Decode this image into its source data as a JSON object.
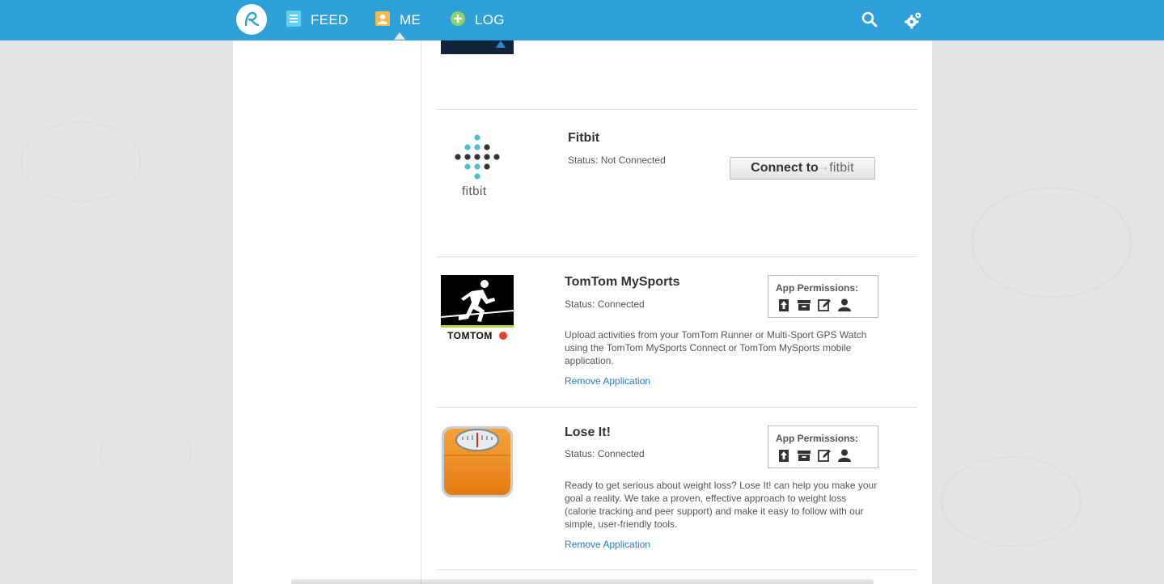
{
  "nav": {
    "logo_icon": "runkeeper-logo-icon",
    "items": [
      {
        "label": "FEED",
        "icon": "feed-icon",
        "icon_color": "#5fd0f2"
      },
      {
        "label": "ME",
        "icon": "me-icon",
        "icon_color": "#f5b94a"
      },
      {
        "label": "LOG",
        "icon": "log-plus-icon",
        "icon_color": "#8dd16a"
      }
    ],
    "search_icon": "search-icon",
    "settings_icon": "gear-icon",
    "bar_color": "#2ea1db"
  },
  "apps": [
    {
      "name": "Fitbit",
      "status": "Status: Not Connected",
      "logo_wordmark": "fitbit",
      "connect_button": {
        "label": "Connect to",
        "brand": "fitbit"
      }
    },
    {
      "name": "TomTom MySports",
      "status": "Status: Connected",
      "logo_wordmark": "TOMTOM",
      "permissions_title": "App Permissions:",
      "description": "Upload activities from your TomTom Runner or Multi-Sport GPS Watch using the TomTom MySports Connect or TomTom MySports mobile application.",
      "remove_label": "Remove Application"
    },
    {
      "name": "Lose It!",
      "status": "Status: Connected",
      "permissions_title": "App Permissions:",
      "description": "Ready to get serious about weight loss? Lose It! can help you make your goal a reality. We take a proven, effective approach to weight loss (calorie tracking and peer support) and make it easy to follow with our simple, user-friendly tools.",
      "remove_label": "Remove Application"
    }
  ],
  "permission_icons": [
    "upload-icon",
    "archive-icon",
    "edit-icon",
    "profile-icon"
  ],
  "colors": {
    "link": "#2a7bc4",
    "fitbit_teal": "#4bc0c8"
  }
}
